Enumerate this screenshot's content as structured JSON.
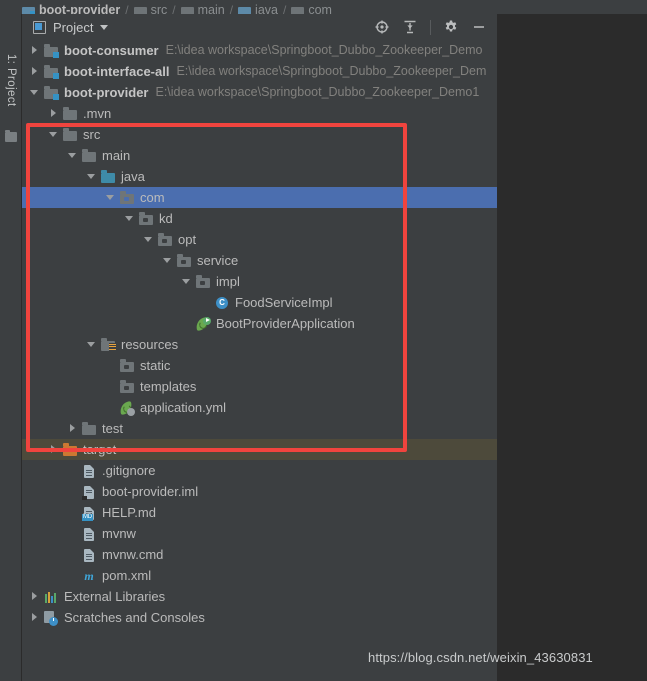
{
  "breadcrumb": {
    "items": [
      {
        "label": "boot-provider",
        "icon": "module-icon",
        "bold": true
      },
      {
        "label": "src",
        "icon": "folder-icon",
        "bold": false
      },
      {
        "label": "main",
        "icon": "folder-icon",
        "bold": false
      },
      {
        "label": "java",
        "icon": "source-folder-icon",
        "bold": false
      },
      {
        "label": "com",
        "icon": "package-icon",
        "bold": false
      }
    ],
    "separator": "/"
  },
  "tool_window_tab": {
    "label": "1: Project",
    "icon": "project-tab-icon"
  },
  "panel_header": {
    "title": "Project",
    "view_icon": "project-view-icon",
    "dropdown_icon": "chevron-down-icon",
    "buttons": [
      {
        "name": "select-opened-file-icon",
        "tooltip": "Select Opened File"
      },
      {
        "name": "collapse-all-icon",
        "tooltip": "Collapse All"
      },
      {
        "name": "settings-gear-icon",
        "tooltip": "Settings"
      },
      {
        "name": "hide-icon",
        "tooltip": "Hide"
      }
    ]
  },
  "tree": [
    {
      "label": "boot-consumer",
      "path": "E:\\idea workspace\\Springboot_Dubbo_Zookeeper_Demo",
      "indent": 0,
      "arrow": "right",
      "icon": "module-icon",
      "bold": true,
      "state": "normal"
    },
    {
      "label": "boot-interface-all",
      "path": "E:\\idea workspace\\Springboot_Dubbo_Zookeeper_Dem",
      "indent": 0,
      "arrow": "right",
      "icon": "module-icon",
      "bold": true,
      "state": "normal"
    },
    {
      "label": "boot-provider",
      "path": "E:\\idea workspace\\Springboot_Dubbo_Zookeeper_Demo1",
      "indent": 0,
      "arrow": "down",
      "icon": "module-icon",
      "bold": true,
      "state": "normal"
    },
    {
      "label": ".mvn",
      "path": "",
      "indent": 1,
      "arrow": "right",
      "icon": "folder-icon",
      "bold": false,
      "state": "normal"
    },
    {
      "label": "src",
      "path": "",
      "indent": 1,
      "arrow": "down",
      "icon": "folder-icon",
      "bold": false,
      "state": "normal"
    },
    {
      "label": "main",
      "path": "",
      "indent": 2,
      "arrow": "down",
      "icon": "folder-icon",
      "bold": false,
      "state": "normal"
    },
    {
      "label": "java",
      "path": "",
      "indent": 3,
      "arrow": "down",
      "icon": "source-folder-icon",
      "bold": false,
      "state": "normal"
    },
    {
      "label": "com",
      "path": "",
      "indent": 4,
      "arrow": "down",
      "icon": "package-icon",
      "bold": false,
      "state": "selected"
    },
    {
      "label": "kd",
      "path": "",
      "indent": 5,
      "arrow": "down",
      "icon": "package-icon",
      "bold": false,
      "state": "normal"
    },
    {
      "label": "opt",
      "path": "",
      "indent": 6,
      "arrow": "down",
      "icon": "package-icon",
      "bold": false,
      "state": "normal"
    },
    {
      "label": "service",
      "path": "",
      "indent": 7,
      "arrow": "down",
      "icon": "package-icon",
      "bold": false,
      "state": "normal"
    },
    {
      "label": "impl",
      "path": "",
      "indent": 8,
      "arrow": "down",
      "icon": "package-icon",
      "bold": false,
      "state": "normal"
    },
    {
      "label": "FoodServiceImpl",
      "path": "",
      "indent": 9,
      "arrow": "none",
      "icon": "java-class-icon",
      "bold": false,
      "state": "normal"
    },
    {
      "label": "BootProviderApplication",
      "path": "",
      "indent": 8,
      "arrow": "none",
      "icon": "spring-boot-run-icon",
      "bold": false,
      "state": "normal"
    },
    {
      "label": "resources",
      "path": "",
      "indent": 3,
      "arrow": "down",
      "icon": "resources-folder-icon",
      "bold": false,
      "state": "normal"
    },
    {
      "label": "static",
      "path": "",
      "indent": 4,
      "arrow": "none",
      "icon": "package-icon",
      "bold": false,
      "state": "normal"
    },
    {
      "label": "templates",
      "path": "",
      "indent": 4,
      "arrow": "none",
      "icon": "package-icon",
      "bold": false,
      "state": "normal"
    },
    {
      "label": "application.yml",
      "path": "",
      "indent": 4,
      "arrow": "none",
      "icon": "spring-yaml-icon",
      "bold": false,
      "state": "normal"
    },
    {
      "label": "test",
      "path": "",
      "indent": 2,
      "arrow": "right",
      "icon": "folder-icon",
      "bold": false,
      "state": "normal"
    },
    {
      "label": "target",
      "path": "",
      "indent": 1,
      "arrow": "right",
      "icon": "excluded-folder-icon",
      "bold": false,
      "state": "hover"
    },
    {
      "label": ".gitignore",
      "path": "",
      "indent": 2,
      "arrow": "none",
      "icon": "file-icon",
      "bold": false,
      "state": "normal"
    },
    {
      "label": "boot-provider.iml",
      "path": "",
      "indent": 2,
      "arrow": "none",
      "icon": "iml-file-icon",
      "bold": false,
      "state": "normal"
    },
    {
      "label": "HELP.md",
      "path": "",
      "indent": 2,
      "arrow": "none",
      "icon": "markdown-file-icon",
      "bold": false,
      "state": "normal"
    },
    {
      "label": "mvnw",
      "path": "",
      "indent": 2,
      "arrow": "none",
      "icon": "file-icon",
      "bold": false,
      "state": "normal"
    },
    {
      "label": "mvnw.cmd",
      "path": "",
      "indent": 2,
      "arrow": "none",
      "icon": "file-icon",
      "bold": false,
      "state": "normal"
    },
    {
      "label": "pom.xml",
      "path": "",
      "indent": 2,
      "arrow": "none",
      "icon": "maven-pom-icon",
      "bold": false,
      "state": "normal"
    },
    {
      "label": "External Libraries",
      "path": "",
      "indent": 0,
      "arrow": "right",
      "icon": "libraries-icon",
      "bold": false,
      "state": "normal"
    },
    {
      "label": "Scratches and Consoles",
      "path": "",
      "indent": 0,
      "arrow": "right",
      "icon": "scratches-icon",
      "bold": false,
      "state": "normal"
    }
  ],
  "annotation": {
    "name": "red-highlight-rectangle",
    "color": "#f0443e"
  },
  "watermark": {
    "text": "https://blog.csdn.net/weixin_43630831"
  },
  "colors": {
    "panel_bg": "#3c3f41",
    "editor_bg": "#2b2b2b",
    "selection": "#4b6eaf",
    "hover": "#4d4a3b",
    "text": "#bbbbbb",
    "path_text": "#82817e",
    "accent_red": "#f0443e"
  }
}
